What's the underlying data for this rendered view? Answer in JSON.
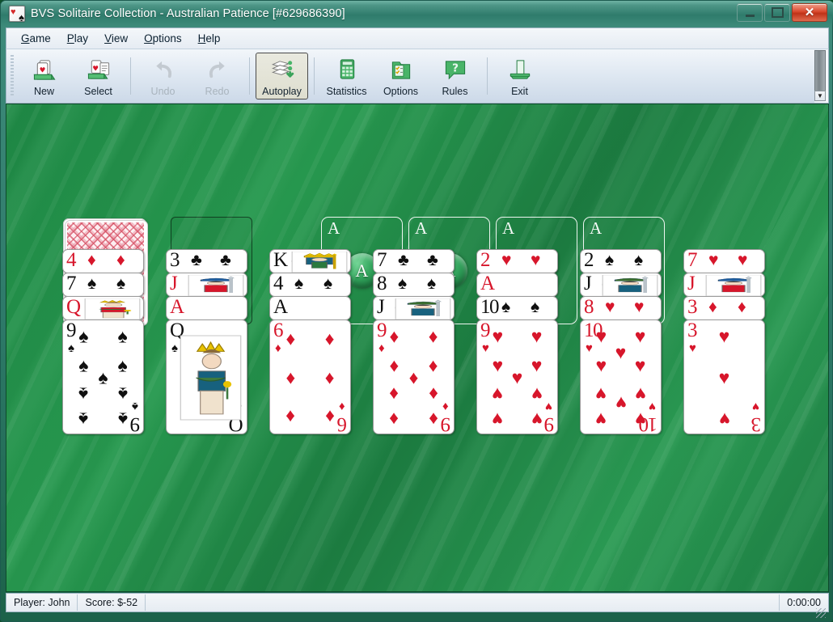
{
  "window": {
    "title": "BVS Solitaire Collection  -  Australian Patience [#629686390]",
    "icon": "cards-icon",
    "buttons": {
      "minimize": "minimize-icon",
      "maximize": "maximize-icon",
      "close": "✕"
    }
  },
  "menu": [
    {
      "label": "Game",
      "accel": "G"
    },
    {
      "label": "Play",
      "accel": "P"
    },
    {
      "label": "View",
      "accel": "V"
    },
    {
      "label": "Options",
      "accel": "O"
    },
    {
      "label": "Help",
      "accel": "H"
    }
  ],
  "toolbar": [
    {
      "label": "New",
      "icon": "new-game-icon",
      "state": "enabled"
    },
    {
      "label": "Select",
      "icon": "select-game-icon",
      "state": "enabled"
    },
    {
      "label": "Undo",
      "icon": "undo-icon",
      "state": "disabled"
    },
    {
      "label": "Redo",
      "icon": "redo-icon",
      "state": "disabled"
    },
    {
      "label": "Autoplay",
      "icon": "autoplay-icon",
      "state": "pressed"
    },
    {
      "label": "Statistics",
      "icon": "statistics-icon",
      "state": "enabled"
    },
    {
      "label": "Options",
      "icon": "options-icon",
      "state": "enabled"
    },
    {
      "label": "Rules",
      "icon": "rules-icon",
      "state": "enabled"
    },
    {
      "label": "Exit",
      "icon": "exit-icon",
      "state": "enabled"
    }
  ],
  "table": {
    "stock": {
      "facedown": true,
      "count_look": "deck"
    },
    "waste": {
      "empty": true
    },
    "foundations": [
      {
        "placeholder": "A"
      },
      {
        "placeholder": "A"
      },
      {
        "placeholder": "A"
      },
      {
        "placeholder": "A"
      }
    ],
    "columns": [
      {
        "cards": [
          {
            "rank": "4",
            "suit": "diamonds"
          },
          {
            "rank": "7",
            "suit": "spades"
          },
          {
            "rank": "Q",
            "suit": "diamonds"
          },
          {
            "rank": "9",
            "suit": "spades"
          }
        ]
      },
      {
        "cards": [
          {
            "rank": "3",
            "suit": "clubs"
          },
          {
            "rank": "J",
            "suit": "diamonds"
          },
          {
            "rank": "A",
            "suit": "hearts"
          },
          {
            "rank": "Q",
            "suit": "spades"
          }
        ]
      },
      {
        "cards": [
          {
            "rank": "K",
            "suit": "spades"
          },
          {
            "rank": "4",
            "suit": "spades"
          },
          {
            "rank": "A",
            "suit": "spades"
          },
          {
            "rank": "6",
            "suit": "diamonds"
          }
        ]
      },
      {
        "cards": [
          {
            "rank": "7",
            "suit": "clubs"
          },
          {
            "rank": "8",
            "suit": "spades"
          },
          {
            "rank": "J",
            "suit": "clubs"
          },
          {
            "rank": "9",
            "suit": "diamonds"
          }
        ]
      },
      {
        "cards": [
          {
            "rank": "2",
            "suit": "hearts"
          },
          {
            "rank": "A",
            "suit": "hearts"
          },
          {
            "rank": "10",
            "suit": "spades"
          },
          {
            "rank": "9",
            "suit": "hearts"
          }
        ]
      },
      {
        "cards": [
          {
            "rank": "2",
            "suit": "spades"
          },
          {
            "rank": "J",
            "suit": "spades"
          },
          {
            "rank": "8",
            "suit": "hearts"
          },
          {
            "rank": "10",
            "suit": "hearts"
          }
        ]
      },
      {
        "cards": [
          {
            "rank": "7",
            "suit": "hearts"
          },
          {
            "rank": "J",
            "suit": "hearts"
          },
          {
            "rank": "3",
            "suit": "diamonds"
          },
          {
            "rank": "3",
            "suit": "hearts"
          }
        ]
      }
    ]
  },
  "statusbar": {
    "player": "Player: John",
    "score": "Score: $-52",
    "time": "0:00:00"
  },
  "colors": {
    "felt": "#1f8a46",
    "title": "#2f7c6c",
    "red_suit": "#d7162b",
    "black_suit": "#101010",
    "close_button": "#d9482c"
  }
}
